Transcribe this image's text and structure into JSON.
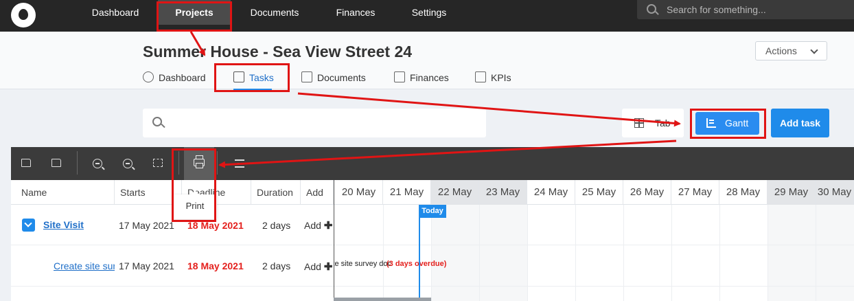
{
  "topnav": {
    "items": [
      "Dashboard",
      "Projects",
      "Documents",
      "Finances",
      "Settings"
    ],
    "active": "Projects",
    "search_placeholder": "Search for something..."
  },
  "header": {
    "title": "Summer House - Sea View Street 24",
    "actions_label": "Actions",
    "tabs": [
      {
        "label": "Dashboard",
        "icon": "dashboard-icon"
      },
      {
        "label": "Tasks",
        "icon": "tasks-icon"
      },
      {
        "label": "Documents",
        "icon": "documents-icon"
      },
      {
        "label": "Finances",
        "icon": "finances-icon"
      },
      {
        "label": "KPIs",
        "icon": "kpis-icon"
      }
    ],
    "active_tab": "Tasks"
  },
  "toolbar": {
    "search_placeholder": "",
    "table_label": "Table",
    "gantt_label": "Gantt",
    "add_task_label": "Add task"
  },
  "gantt_toolbar": {
    "icons": [
      "collapse-all-icon",
      "expand-all-icon",
      "zoom-in-icon",
      "zoom-out-icon",
      "fit-screen-icon",
      "print-icon",
      "indent-icon"
    ],
    "tooltip": "Print"
  },
  "grid": {
    "columns": [
      "Name",
      "Starts",
      "Deadline",
      "Duration",
      "Add"
    ],
    "dates": [
      "20 May",
      "21 May",
      "22 May",
      "23 May",
      "24 May",
      "25 May",
      "26 May",
      "27 May",
      "28 May",
      "29 May",
      "30 May"
    ],
    "weekend_dates": [
      "22 May",
      "23 May",
      "29 May",
      "30 May"
    ],
    "today_label": "Today",
    "rows": [
      {
        "name": "Site Visit",
        "starts": "17 May 2021",
        "deadline": "18 May 2021",
        "duration": "2 days",
        "add": "Add"
      },
      {
        "name": "Create site survey document",
        "starts": "17 May 2021",
        "deadline": "18 May 2021",
        "duration": "2 days",
        "add": "Add",
        "bar_label": "Create site survey doc",
        "overdue": "(3 days overdue)"
      }
    ]
  },
  "colors": {
    "nav_bg": "#262626",
    "accent": "#1f8bea",
    "overdue": "#e4201d",
    "annotation": "#e01414"
  }
}
